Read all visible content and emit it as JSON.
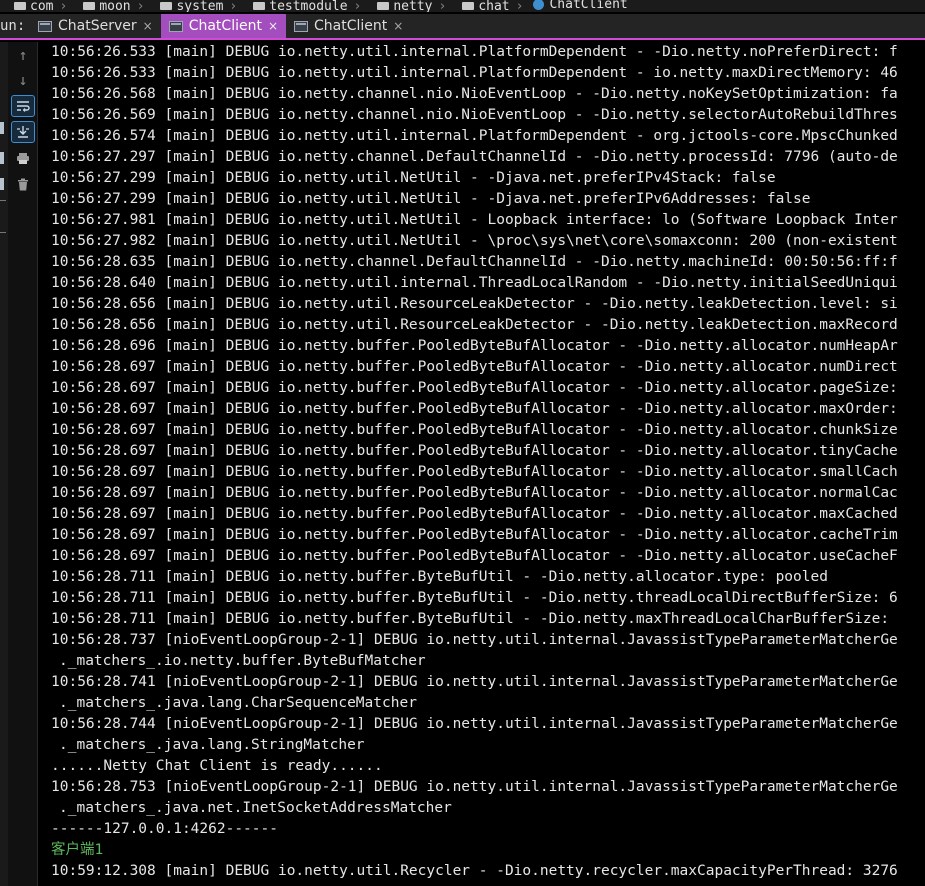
{
  "breadcrumb": [
    "com",
    "moon",
    "system",
    "testmodule",
    "netty",
    "chat",
    "ChatClient"
  ],
  "run_label": "un:",
  "tabs": [
    {
      "label": "ChatServer",
      "active": false
    },
    {
      "label": "ChatClient",
      "active": true
    },
    {
      "label": "ChatClient",
      "active": false
    }
  ],
  "toolbar": [
    "up-arrow-icon",
    "down-arrow-icon",
    "soft-wrap-icon",
    "scroll-to-end-icon",
    "print-icon",
    "trash-icon"
  ],
  "colors": {
    "tab_accent": "#a44dbf",
    "user_output": "#5bb95b",
    "background": "#000000"
  },
  "console": {
    "lines": [
      "10:56:26.533 [main] DEBUG io.netty.util.internal.PlatformDependent - -Dio.netty.noPreferDirect: f",
      "10:56:26.533 [main] DEBUG io.netty.util.internal.PlatformDependent - io.netty.maxDirectMemory: 46",
      "10:56:26.568 [main] DEBUG io.netty.channel.nio.NioEventLoop - -Dio.netty.noKeySetOptimization: fa",
      "10:56:26.569 [main] DEBUG io.netty.channel.nio.NioEventLoop - -Dio.netty.selectorAutoRebuildThres",
      "10:56:26.574 [main] DEBUG io.netty.util.internal.PlatformDependent - org.jctools-core.MpscChunked",
      "10:56:27.297 [main] DEBUG io.netty.channel.DefaultChannelId - -Dio.netty.processId: 7796 (auto-de",
      "10:56:27.299 [main] DEBUG io.netty.util.NetUtil - -Djava.net.preferIPv4Stack: false",
      "10:56:27.299 [main] DEBUG io.netty.util.NetUtil - -Djava.net.preferIPv6Addresses: false",
      "10:56:27.981 [main] DEBUG io.netty.util.NetUtil - Loopback interface: lo (Software Loopback Inter",
      "10:56:27.982 [main] DEBUG io.netty.util.NetUtil - \\proc\\sys\\net\\core\\somaxconn: 200 (non-existent",
      "10:56:28.635 [main] DEBUG io.netty.channel.DefaultChannelId - -Dio.netty.machineId: 00:50:56:ff:f",
      "10:56:28.640 [main] DEBUG io.netty.util.internal.ThreadLocalRandom - -Dio.netty.initialSeedUniqui",
      "10:56:28.656 [main] DEBUG io.netty.util.ResourceLeakDetector - -Dio.netty.leakDetection.level: si",
      "10:56:28.656 [main] DEBUG io.netty.util.ResourceLeakDetector - -Dio.netty.leakDetection.maxRecord",
      "10:56:28.696 [main] DEBUG io.netty.buffer.PooledByteBufAllocator - -Dio.netty.allocator.numHeapAr",
      "10:56:28.697 [main] DEBUG io.netty.buffer.PooledByteBufAllocator - -Dio.netty.allocator.numDirect",
      "10:56:28.697 [main] DEBUG io.netty.buffer.PooledByteBufAllocator - -Dio.netty.allocator.pageSize:",
      "10:56:28.697 [main] DEBUG io.netty.buffer.PooledByteBufAllocator - -Dio.netty.allocator.maxOrder:",
      "10:56:28.697 [main] DEBUG io.netty.buffer.PooledByteBufAllocator - -Dio.netty.allocator.chunkSize",
      "10:56:28.697 [main] DEBUG io.netty.buffer.PooledByteBufAllocator - -Dio.netty.allocator.tinyCache",
      "10:56:28.697 [main] DEBUG io.netty.buffer.PooledByteBufAllocator - -Dio.netty.allocator.smallCach",
      "10:56:28.697 [main] DEBUG io.netty.buffer.PooledByteBufAllocator - -Dio.netty.allocator.normalCac",
      "10:56:28.697 [main] DEBUG io.netty.buffer.PooledByteBufAllocator - -Dio.netty.allocator.maxCached",
      "10:56:28.697 [main] DEBUG io.netty.buffer.PooledByteBufAllocator - -Dio.netty.allocator.cacheTrim",
      "10:56:28.697 [main] DEBUG io.netty.buffer.PooledByteBufAllocator - -Dio.netty.allocator.useCacheF",
      "10:56:28.711 [main] DEBUG io.netty.buffer.ByteBufUtil - -Dio.netty.allocator.type: pooled",
      "10:56:28.711 [main] DEBUG io.netty.buffer.ByteBufUtil - -Dio.netty.threadLocalDirectBufferSize: 6",
      "10:56:28.711 [main] DEBUG io.netty.buffer.ByteBufUtil - -Dio.netty.maxThreadLocalCharBufferSize:",
      "10:56:28.737 [nioEventLoopGroup-2-1] DEBUG io.netty.util.internal.JavassistTypeParameterMatcherGe",
      "._matchers_.io.netty.buffer.ByteBufMatcher",
      "10:56:28.741 [nioEventLoopGroup-2-1] DEBUG io.netty.util.internal.JavassistTypeParameterMatcherGe",
      "._matchers_.java.lang.CharSequenceMatcher",
      "10:56:28.744 [nioEventLoopGroup-2-1] DEBUG io.netty.util.internal.JavassistTypeParameterMatcherGe",
      "._matchers_.java.lang.StringMatcher",
      "......Netty Chat Client is ready......",
      "10:56:28.753 [nioEventLoopGroup-2-1] DEBUG io.netty.util.internal.JavassistTypeParameterMatcherGe",
      "._matchers_.java.net.InetSocketAddressMatcher",
      "------127.0.0.1:4262------",
      "客户端1",
      "10:59:12.308 [main] DEBUG io.netty.util.Recycler - -Dio.netty.recycler.maxCapacityPerThread: 3276"
    ],
    "continuation_lines": [
      29,
      31,
      33,
      36
    ],
    "user_input_lines": [
      38
    ]
  }
}
